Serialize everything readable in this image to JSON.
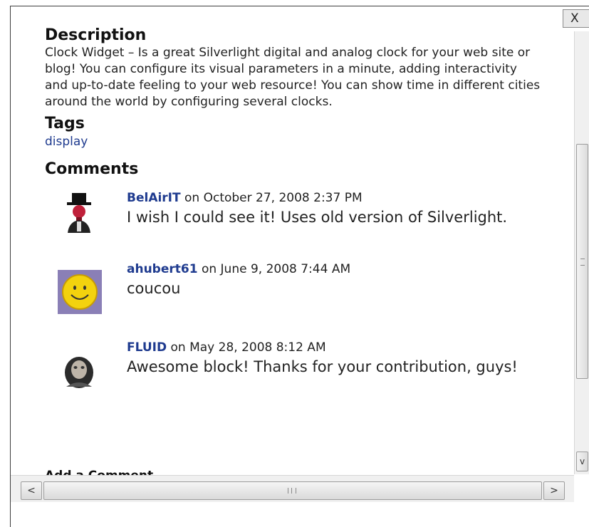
{
  "description": {
    "heading": "Description",
    "text": "Clock Widget – Is a great Silverlight digital and analog clock for your web site or blog! You can configure its visual parameters in a minute, adding interactivity and up-to-date feeling to your web resource! You can show time in different cities around the world by configuring several clocks."
  },
  "tags": {
    "heading": "Tags",
    "items": [
      "display"
    ]
  },
  "comments": {
    "heading": "Comments",
    "items": [
      {
        "author": "BelAirIT",
        "date": " on October 27, 2008 2:37 PM",
        "text": "I wish I could see it! Uses old version of Silverlight.",
        "avatar": "top-hat-character-avatar"
      },
      {
        "author": "ahubert61",
        "date": " on June 9, 2008 7:44 AM",
        "text": "coucou",
        "avatar": "smiley-face-avatar"
      },
      {
        "author": "FLUID",
        "date": " on May 28, 2008 8:12 AM",
        "text": "Awesome block! Thanks for your contribution, guys!",
        "avatar": "portrait-avatar"
      }
    ]
  },
  "add_comment": "Add a Comment",
  "close_label": "X",
  "scroll": {
    "left_arrow": "<",
    "right_arrow": ">",
    "down_arrow": "v"
  }
}
